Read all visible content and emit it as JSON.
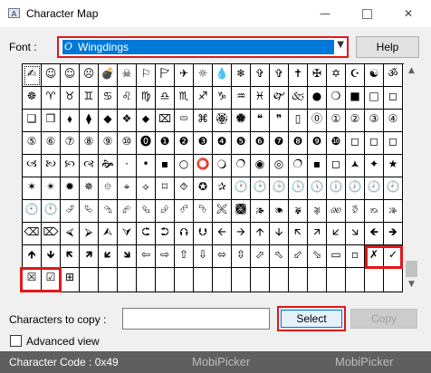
{
  "window": {
    "title": "Character Map",
    "minimize_glyph": "—",
    "close_glyph": "✕"
  },
  "font": {
    "label": "Font :",
    "selected": "Wingdings",
    "truetype_glyph": "O",
    "dropdown_glyph": "▼"
  },
  "buttons": {
    "help": "Help",
    "select": "Select",
    "copy": "Copy"
  },
  "grid": {
    "rows": [
      [
        "✍",
        "☺",
        "☺",
        "☹",
        "💣",
        "☠",
        "⚐",
        "🏱",
        "✈",
        "☼",
        "💧",
        "❄",
        "✞",
        "✞",
        "✝",
        "✠",
        "✡",
        "☪",
        "☯",
        "ॐ"
      ],
      [
        "☸",
        "♈",
        "♉",
        "♊",
        "♋",
        "♌",
        "♍",
        "♎",
        "♏",
        "♐",
        "♑",
        "♒",
        "♓",
        "🙰",
        "🙵",
        "●",
        "❍",
        "■",
        "□",
        "◻"
      ],
      [
        "❑",
        "❒",
        "⬧",
        "⧫",
        "◆",
        "❖",
        "⬥",
        "⌧",
        "⮹",
        "⌘",
        "🏵",
        "🏶",
        "❝",
        "❞",
        "▯",
        "⓪",
        "①",
        "②",
        "③",
        "④"
      ],
      [
        "⑤",
        "⑥",
        "⑦",
        "⑧",
        "⑨",
        "⑩",
        "⓿",
        "❶",
        "❷",
        "❸",
        "❹",
        "❺",
        "❻",
        "❼",
        "❽",
        "❾",
        "❿",
        "◻",
        "◻",
        "◻"
      ],
      [
        "🙢",
        "🙠",
        "🙡",
        "🙣",
        "🙞",
        "·",
        "•",
        "▪",
        "○",
        "⭕",
        "🔾",
        "🔿",
        "◉",
        "◎",
        "🔿",
        "▪",
        "◻",
        "🟂",
        "✦",
        "★"
      ],
      [
        "✶",
        "✴",
        "✹",
        "✵",
        "⯐",
        "⌖",
        "⟡",
        "⌑",
        "⯑",
        "✪",
        "✰",
        "🕐",
        "🕑",
        "🕒",
        "🕓",
        "🕔",
        "🕕",
        "🕖",
        "🕗",
        "🕘"
      ],
      [
        "🕙",
        "🕚",
        "⮰",
        "⮱",
        "⮲",
        "⮳",
        "⮴",
        "⮵",
        "⮶",
        "⮷",
        "🙪",
        "🙫",
        "🙕",
        "🙔",
        "🙗",
        "🙖",
        "🙐",
        "🙑",
        "🙒",
        "🙓"
      ],
      [
        "⌫",
        "⌦",
        "⮘",
        "⮚",
        "⮙",
        "⮛",
        "⮈",
        "⮊",
        "⮉",
        "⮋",
        "🡨",
        "🡪",
        "🡩",
        "🡫",
        "🡬",
        "🡭",
        "🡯",
        "🡮",
        "🡸",
        "🡺"
      ],
      [
        "🡹",
        "🡻",
        "🡼",
        "🡽",
        "🡿",
        "🡾",
        "⇦",
        "⇨",
        "⇧",
        "⇩",
        "⬄",
        "⇳",
        "⬀",
        "⬁",
        "⬃",
        "⬂",
        "▭",
        "▫",
        "✗",
        "✓"
      ],
      [
        "☒",
        "☑",
        "⊞",
        "",
        "",
        "",
        "",
        "",
        "",
        "",
        "",
        "",
        "",
        "",
        "",
        "",
        "",
        "",
        "",
        ""
      ]
    ]
  },
  "copy": {
    "label": "Characters to copy :",
    "value": ""
  },
  "advanced": {
    "label": "Advanced view"
  },
  "status": {
    "text": "Character Code : 0x49"
  },
  "watermark": {
    "text": "MobiPicker"
  },
  "colors": {
    "highlight": "#e01818",
    "selection": "#0078d7",
    "statusbar": "#5f5f5f"
  }
}
